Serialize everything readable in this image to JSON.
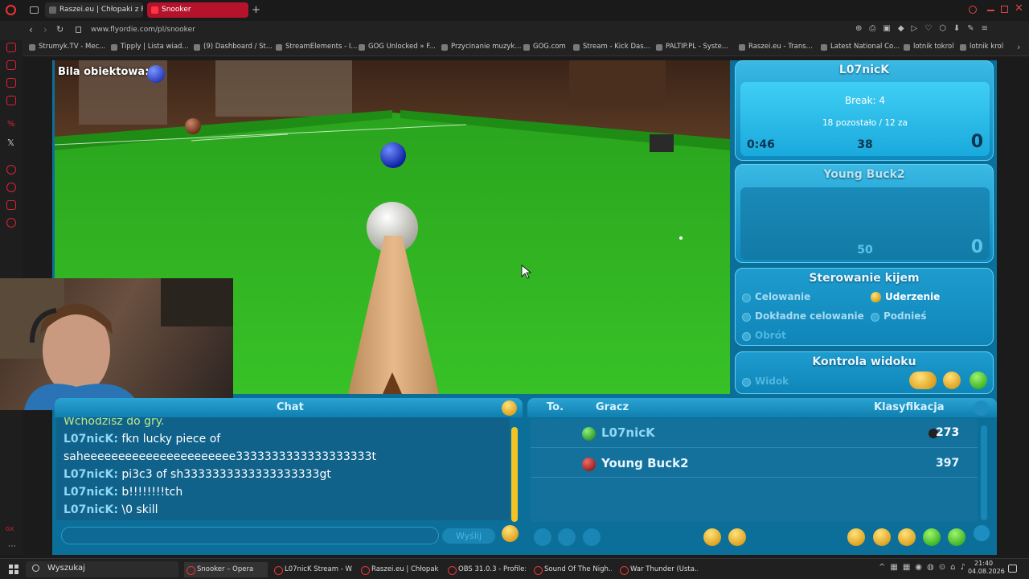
{
  "browser": {
    "tabs": [
      {
        "label": "Raszei.eu | Chłopaki z Rasz",
        "active": false
      },
      {
        "label": "Snooker",
        "active": true
      }
    ],
    "url": "www.flyordie.com/pl/snooker",
    "bookmarks": [
      "Strumyk.TV - Mec...",
      "Tipply | Lista wiad...",
      "(9) Dashboard / St...",
      "StreamElements - I...",
      "GOG Unlocked » F...",
      "Przycinanie muzyk...",
      "GOG.com",
      "Stream - Kick Das...",
      "PALTIP.PL - Syste...",
      "Raszei.eu - Trans...",
      "Latest National Co...",
      "lotnik tokrol",
      "lotnik krol"
    ]
  },
  "game": {
    "object_ball_label": "Bila obiektowa:",
    "player1": {
      "name": "L07nicK",
      "break": "Break: 4",
      "remaining": "18 pozostało / 12 za",
      "time": "0:46",
      "points": "38",
      "score": "0"
    },
    "player2": {
      "name": "Young Buck2",
      "points": "50",
      "score": "0"
    },
    "cue_control": {
      "title": "Sterowanie kijem",
      "options": [
        "Celowanie",
        "Uderzenie",
        "Dokładne celowanie",
        "Podnieś",
        "Obrót"
      ],
      "selected": "Uderzenie"
    },
    "view_control": {
      "title": "Kontrola widoku",
      "view_label": "Widok"
    },
    "chat": {
      "title": "Chat",
      "system_line": "Wchodzisz do gry.",
      "messages": [
        {
          "user": "L07nicK:",
          "text": "fkn lucky piece of"
        },
        {
          "user": "",
          "text": "saheeeeeeeeeeeeeeeeeeeeee3333333333333333333t"
        },
        {
          "user": "L07nicK:",
          "text": "pi3c3 of sh3333333333333333333gt"
        },
        {
          "user": "L07nicK:",
          "text": "b!!!!!!!!tch"
        },
        {
          "user": "L07nicK:",
          "text": "\\0 skill"
        }
      ],
      "send_label": "Wyślij"
    },
    "scoreboard": {
      "headers": {
        "to": "To.",
        "player": "Gracz",
        "rank": "Klasyfikacja"
      },
      "rows": [
        {
          "name": "L07nicK",
          "rating": "273",
          "ball_color": "#1aa12a"
        },
        {
          "name": "Young Buck2",
          "rating": "397",
          "ball_color": "#b01010"
        }
      ]
    }
  },
  "taskbar": {
    "search": "Wyszukaj",
    "apps": [
      "Snooker – Opera",
      "L07nicK Stream - W...",
      "Raszei.eu | Chłopak...",
      "OBS 31.0.3 - Profile:...",
      "Sound Of The Nigh...",
      "War Thunder (Usta..."
    ],
    "time": "21:40",
    "date": "04.08.2026"
  }
}
